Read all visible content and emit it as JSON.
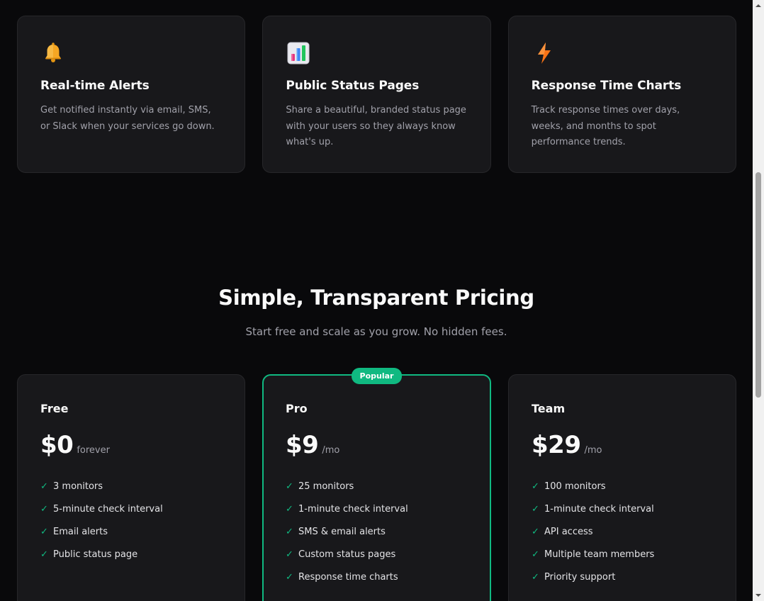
{
  "features": [
    {
      "icon": "bell-icon",
      "title": "Real-time Alerts",
      "desc": "Get notified instantly via email, SMS, or Slack when your services go down."
    },
    {
      "icon": "bar-chart-icon",
      "title": "Public Status Pages",
      "desc": "Share a beautiful, branded status page with your users so they always know what's up."
    },
    {
      "icon": "lightning-icon",
      "title": "Response Time Charts",
      "desc": "Track response times over days, weeks, and months to spot performance trends."
    }
  ],
  "pricing": {
    "title": "Simple, Transparent Pricing",
    "subtitle": "Start free and scale as you grow. No hidden fees.",
    "check_symbol": "✓",
    "plans": [
      {
        "name": "Free",
        "price": "$0",
        "period": "forever",
        "badge": "",
        "features": [
          "3 monitors",
          "5-minute check interval",
          "Email alerts",
          "Public status page"
        ]
      },
      {
        "name": "Pro",
        "price": "$9",
        "period": "/mo",
        "badge": "Popular",
        "features": [
          "25 monitors",
          "1-minute check interval",
          "SMS & email alerts",
          "Custom status pages",
          "Response time charts"
        ]
      },
      {
        "name": "Team",
        "price": "$29",
        "period": "/mo",
        "badge": "",
        "features": [
          "100 monitors",
          "1-minute check interval",
          "API access",
          "Multiple team members",
          "Priority support"
        ]
      }
    ]
  },
  "colors": {
    "accent": "#10b981",
    "background": "#09090b",
    "card": "#18181b",
    "border": "#27272a",
    "muted_text": "#a1a1aa"
  }
}
